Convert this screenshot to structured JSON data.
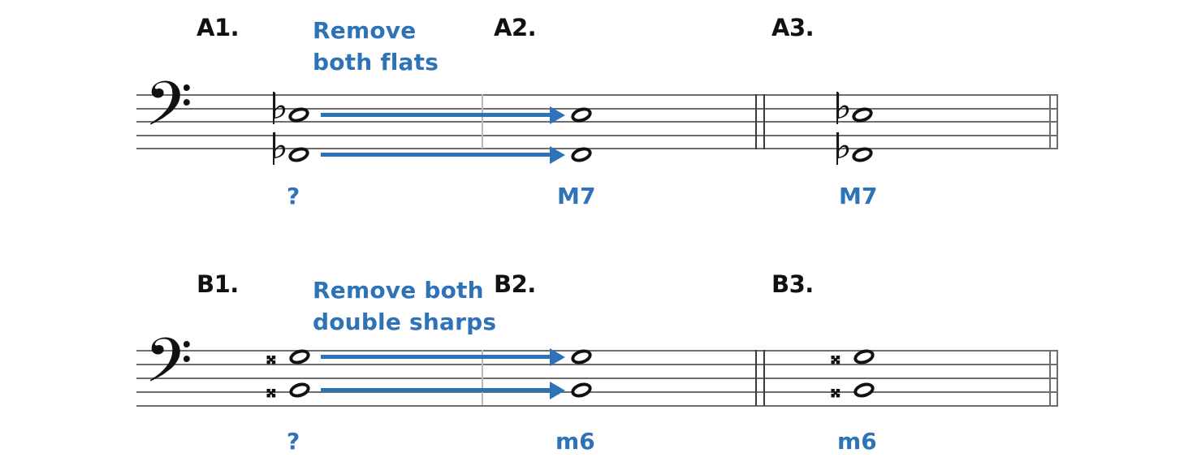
{
  "colors": {
    "accent_blue": "#2e72b8",
    "staff_gray": "#6e6e6e",
    "ink_black": "#111111",
    "background": "#ffffff"
  },
  "exercises": [
    {
      "id": "A",
      "instruction": "Remove\nboth flats",
      "instruction_line1": "Remove",
      "instruction_line2": "both flats",
      "clef": "bass-clef",
      "measures": [
        {
          "label": "A1.",
          "answer": "?",
          "accidental": "flat",
          "accidental_glyph": "♭",
          "notes": [
            "upper",
            "lower"
          ]
        },
        {
          "label": "A2.",
          "answer": "M7",
          "accidental": "none",
          "accidental_glyph": "",
          "notes": [
            "upper",
            "lower"
          ]
        },
        {
          "label": "A3.",
          "answer": "M7",
          "accidental": "flat",
          "accidental_glyph": "♭",
          "notes": [
            "upper",
            "lower"
          ]
        }
      ]
    },
    {
      "id": "B",
      "instruction": "Remove both\ndouble sharps",
      "instruction_line1": "Remove both",
      "instruction_line2": "double sharps",
      "clef": "bass-clef",
      "measures": [
        {
          "label": "B1.",
          "answer": "?",
          "accidental": "double-sharp",
          "accidental_glyph": "𝄪",
          "notes": [
            "upper",
            "lower"
          ]
        },
        {
          "label": "B2.",
          "answer": "m6",
          "accidental": "none",
          "accidental_glyph": "",
          "notes": [
            "upper",
            "lower"
          ]
        },
        {
          "label": "B3.",
          "answer": "m6",
          "accidental": "double-sharp",
          "accidental_glyph": "𝄪",
          "notes": [
            "upper",
            "lower"
          ]
        }
      ]
    }
  ],
  "clef_glyph": "𝄢",
  "notehead_glyph": "𝅝"
}
